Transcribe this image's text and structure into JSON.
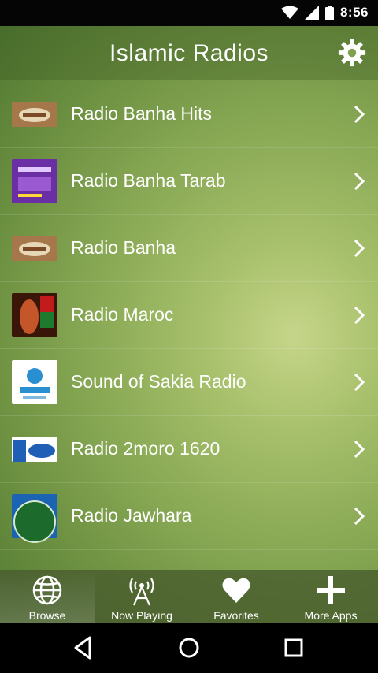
{
  "status": {
    "time": "8:56"
  },
  "header": {
    "title": "Islamic Radios",
    "settings_icon": "gear-icon"
  },
  "stations": [
    {
      "name": "Radio Banha Hits",
      "logo": "banha-logo"
    },
    {
      "name": "Radio Banha Tarab",
      "logo": "banhacity-logo"
    },
    {
      "name": "Radio Banha",
      "logo": "banha-logo"
    },
    {
      "name": "Radio Maroc",
      "logo": "maroc-logo"
    },
    {
      "name": "Sound of Sakia Radio",
      "logo": "sakia-logo"
    },
    {
      "name": "Radio 2moro 1620",
      "logo": "2moro-logo"
    },
    {
      "name": "Radio Jawhara",
      "logo": "jawhara-logo"
    }
  ],
  "tabs": [
    {
      "label": "Browse",
      "icon": "globe-icon",
      "active": true
    },
    {
      "label": "Now Playing",
      "icon": "antenna-icon",
      "active": false
    },
    {
      "label": "Favorites",
      "icon": "heart-icon",
      "active": false
    },
    {
      "label": "More Apps",
      "icon": "plus-icon",
      "active": false
    }
  ],
  "colors": {
    "background": "#8aaa56",
    "text": "#ffffff"
  }
}
